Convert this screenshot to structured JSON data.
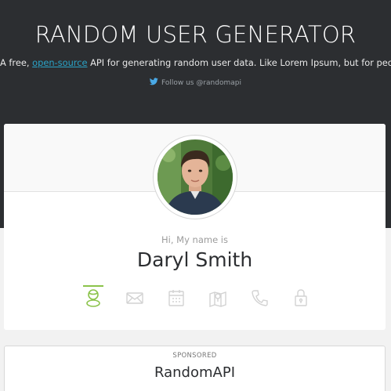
{
  "header": {
    "title": "RANDOM USER GENERATOR",
    "tagline_prefix": "A free, ",
    "tagline_link": "open-source",
    "tagline_suffix": " API for generating random user data. Like Lorem Ipsum, but for people.",
    "follow_text": "Follow us @randomapi",
    "follow_icon": "twitter-bird-icon"
  },
  "user": {
    "greeting": "Hi, My name is",
    "name": "Daryl Smith"
  },
  "tabs": [
    {
      "id": "name",
      "icon": "user-icon",
      "active": true
    },
    {
      "id": "email",
      "icon": "envelope-icon",
      "active": false
    },
    {
      "id": "birthday",
      "icon": "calendar-icon",
      "active": false
    },
    {
      "id": "location",
      "icon": "map-icon",
      "active": false
    },
    {
      "id": "phone",
      "icon": "phone-icon",
      "active": false
    },
    {
      "id": "password",
      "icon": "lock-icon",
      "active": false
    }
  ],
  "sponsor": {
    "label": "SPONSORED",
    "name": "RandomAPI"
  },
  "colors": {
    "hero_bg": "#2c2e31",
    "link": "#2aa3c7",
    "active_icon": "#8bc34a",
    "inactive_icon": "#d2d2d2"
  }
}
